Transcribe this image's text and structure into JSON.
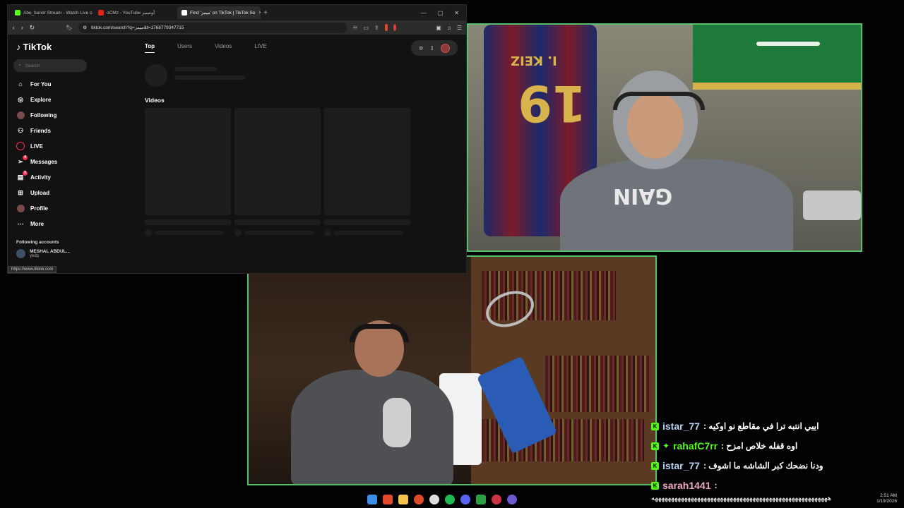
{
  "browser": {
    "tabs": [
      {
        "title": "Abu_bandr Stream - Watch Live o",
        "fav": "#53fc18"
      },
      {
        "title": "oCMz - YouTube أوتسبز",
        "fav": "#e62117"
      },
      {
        "title": "Find 'ميمز' on TikTok | TikTok Se",
        "fav": "#ffffff",
        "active": true
      }
    ],
    "new_tab": "+",
    "win_controls": [
      "—",
      "▢",
      "✕"
    ],
    "url": "tiktok.com/search?q=ميمز&t=1768779347715",
    "status_url": "https://www.tiktok.com"
  },
  "tiktok": {
    "logo": "TikTok",
    "search_placeholder": "Search",
    "nav": [
      {
        "label": "For You",
        "icon": "home-icon",
        "glyph": "⌂"
      },
      {
        "label": "Explore",
        "icon": "compass-icon",
        "glyph": "◎"
      },
      {
        "label": "Following",
        "icon": "following-avatar-icon",
        "glyph": ""
      },
      {
        "label": "Friends",
        "icon": "friends-icon",
        "glyph": "⚇"
      },
      {
        "label": "LIVE",
        "icon": "live-icon",
        "glyph": ""
      },
      {
        "label": "Messages",
        "icon": "messages-icon",
        "glyph": "➢",
        "badge": "4"
      },
      {
        "label": "Activity",
        "icon": "activity-icon",
        "glyph": "▤",
        "badge": "5"
      },
      {
        "label": "Upload",
        "icon": "upload-icon",
        "glyph": "⊞"
      },
      {
        "label": "Profile",
        "icon": "profile-avatar-icon",
        "glyph": ""
      },
      {
        "label": "More",
        "icon": "more-icon",
        "glyph": "⋯"
      }
    ],
    "following_heading": "Following accounts",
    "following": [
      {
        "name": "MESHAL ABDUL...",
        "handle": "yedp"
      }
    ],
    "tabs": [
      "Top",
      "Users",
      "Videos",
      "LIVE"
    ],
    "videos_label": "Videos"
  },
  "chat": [
    {
      "user": "istar_77",
      "color": "#b9d4f4",
      "text": "اييي انتبه ترا في مقاطع نو اوكيه :"
    },
    {
      "user": "rahafC7rr",
      "color": "#53fc18",
      "text": "اوه قفله خلاص امزح :",
      "badge": "✦"
    },
    {
      "user": "istar_77",
      "color": "#b9d4f4",
      "text": "ودنا نضحك كبر الشاشه ما اشوف :"
    },
    {
      "user": "sarah1441",
      "color": "#f0a7c7",
      "text": ":"
    }
  ],
  "kick_badge": "K",
  "marquee": "ههههههههههههههههههههههههههههههههههههههههههههههههههههههه",
  "clock": {
    "time": "2:51 AM",
    "date": "1/19/2026"
  },
  "jersey": {
    "name": "I. KEIZ",
    "number": "19"
  },
  "hoodie_text": "GAIN",
  "colors": {
    "accent_green": "#53c16a",
    "tiktok_red": "#fe2c55"
  }
}
